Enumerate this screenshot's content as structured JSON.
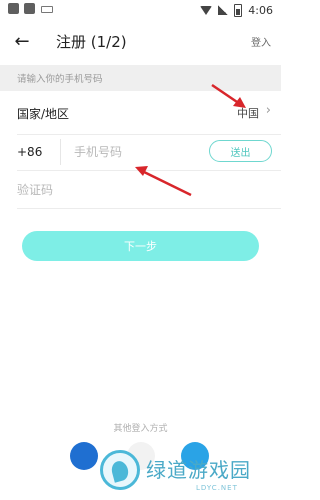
{
  "statusbar": {
    "time": "4:06"
  },
  "header": {
    "back_icon": "arrow-left-icon",
    "title": "注册 (1/2)",
    "login_link": "登入"
  },
  "hint": "请输入你的手机号码",
  "form": {
    "country_label": "国家/地区",
    "country_value": "中国",
    "country_code": "+86",
    "phone_placeholder": "手机号码",
    "send_button": "送出",
    "code_placeholder": "验证码",
    "next_button": "下一步"
  },
  "other_login": {
    "label": "其他登入方式",
    "icons": [
      "facebook-icon",
      "google-icon",
      "twitter-icon"
    ]
  },
  "watermark": {
    "text": "绿道游戏园",
    "sub": "LDYC.NET"
  },
  "colors": {
    "accent": "#7eeee6",
    "send_border": "#6fd7cf",
    "arrow": "#d8262b"
  }
}
